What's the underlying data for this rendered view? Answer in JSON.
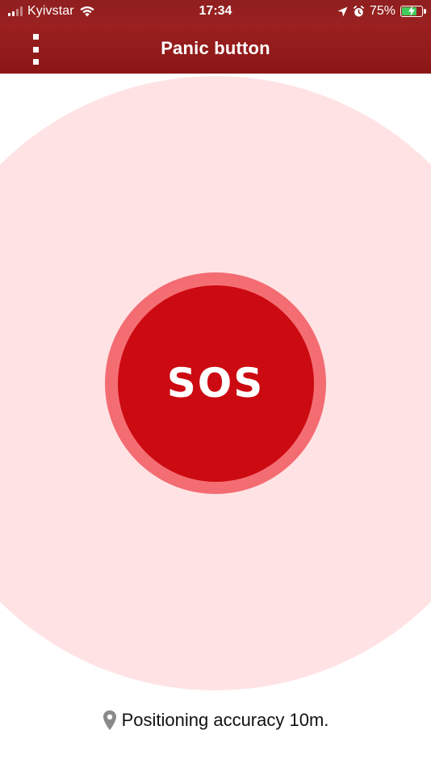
{
  "status_bar": {
    "carrier": "Kyivstar",
    "time": "17:34",
    "battery_percent": "75%",
    "battery_level": 0.75,
    "icons": [
      "signal-icon",
      "wifi-icon",
      "location-arrow-icon",
      "alarm-icon",
      "battery-charging-icon"
    ]
  },
  "header": {
    "title": "Panic button",
    "menu_icon": "more-vertical-icon"
  },
  "main": {
    "sos_label": "SOS"
  },
  "footer": {
    "icon": "location-pin-icon",
    "accuracy_text": "Positioning accuracy 10m."
  },
  "colors": {
    "header": "#8f1f20",
    "sos_button": "#cc0a11",
    "sos_ring": "#f36a70",
    "halo": "#ffe3e4",
    "battery_fill": "#3fce5b"
  }
}
